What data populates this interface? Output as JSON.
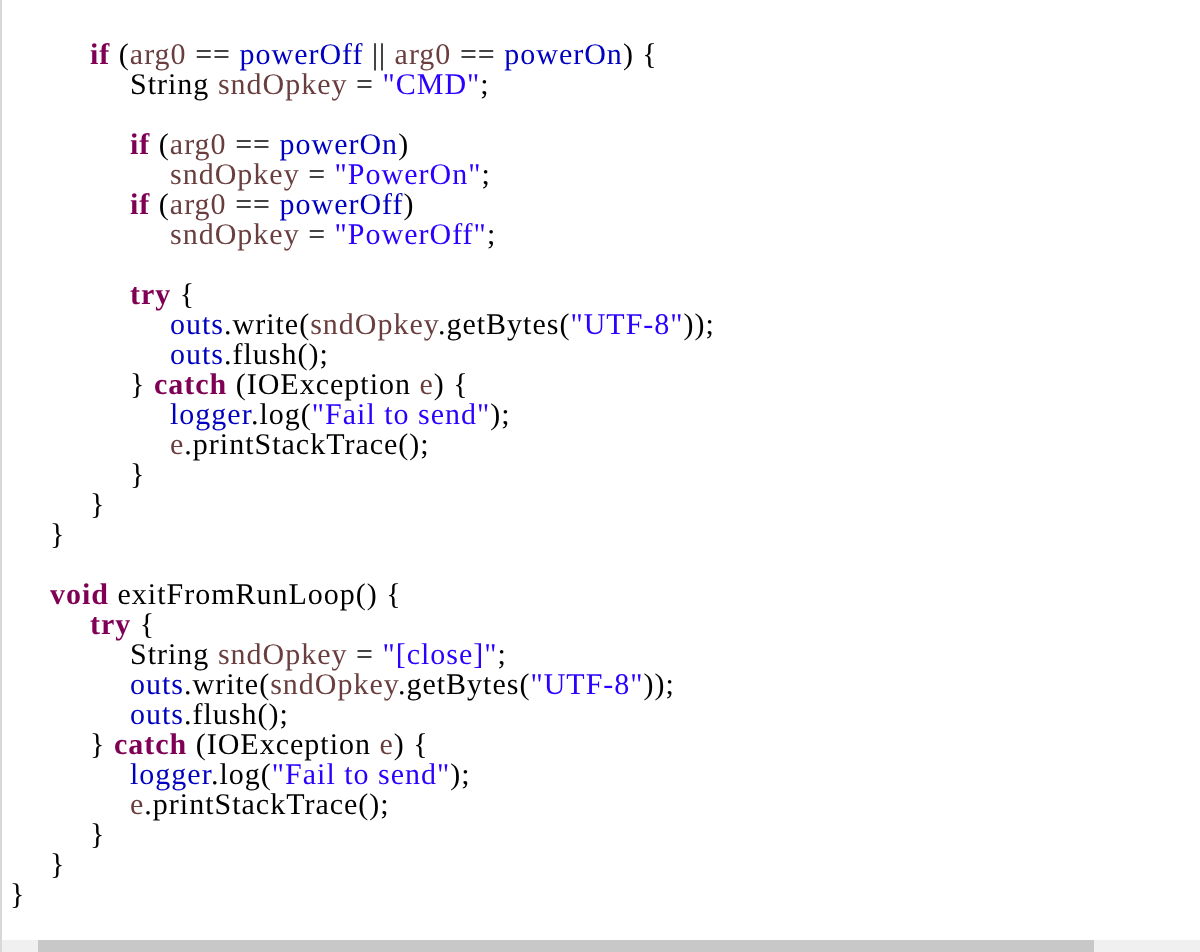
{
  "editor": {
    "lines": [
      {
        "kind": "group",
        "children": [
          {
            "kind": "group",
            "children": [
              {
                "kind": "blank"
              },
              {
                "kind": "code",
                "tokens": [
                  {
                    "kind": "keyword",
                    "text": "if"
                  },
                  {
                    "kind": "plain",
                    "text": " ("
                  },
                  {
                    "kind": "local",
                    "text": "arg0"
                  },
                  {
                    "kind": "plain",
                    "text": " == "
                  },
                  {
                    "kind": "field",
                    "text": "powerOff"
                  },
                  {
                    "kind": "plain",
                    "text": " || "
                  },
                  {
                    "kind": "local",
                    "text": "arg0"
                  },
                  {
                    "kind": "plain",
                    "text": " == "
                  },
                  {
                    "kind": "field",
                    "text": "powerOn"
                  },
                  {
                    "kind": "plain",
                    "text": ") {"
                  }
                ],
                "children": [
                  {
                    "kind": "code",
                    "tokens": [
                      {
                        "kind": "plain",
                        "text": "String "
                      },
                      {
                        "kind": "local",
                        "text": "sndOpkey"
                      },
                      {
                        "kind": "plain",
                        "text": " = "
                      },
                      {
                        "kind": "string",
                        "text": "\"CMD\""
                      },
                      {
                        "kind": "plain",
                        "text": ";"
                      }
                    ]
                  },
                  {
                    "kind": "blank"
                  },
                  {
                    "kind": "code",
                    "tokens": [
                      {
                        "kind": "keyword",
                        "text": "if"
                      },
                      {
                        "kind": "plain",
                        "text": " ("
                      },
                      {
                        "kind": "local",
                        "text": "arg0"
                      },
                      {
                        "kind": "plain",
                        "text": " == "
                      },
                      {
                        "kind": "field",
                        "text": "powerOn"
                      },
                      {
                        "kind": "plain",
                        "text": ")"
                      }
                    ],
                    "children": [
                      {
                        "kind": "code",
                        "tokens": [
                          {
                            "kind": "local",
                            "text": "sndOpkey"
                          },
                          {
                            "kind": "plain",
                            "text": " = "
                          },
                          {
                            "kind": "string",
                            "text": "\"PowerOn\""
                          },
                          {
                            "kind": "plain",
                            "text": ";"
                          }
                        ]
                      }
                    ]
                  },
                  {
                    "kind": "code",
                    "tokens": [
                      {
                        "kind": "keyword",
                        "text": "if"
                      },
                      {
                        "kind": "plain",
                        "text": " ("
                      },
                      {
                        "kind": "local",
                        "text": "arg0"
                      },
                      {
                        "kind": "plain",
                        "text": " == "
                      },
                      {
                        "kind": "field",
                        "text": "powerOff"
                      },
                      {
                        "kind": "plain",
                        "text": ")"
                      }
                    ],
                    "children": [
                      {
                        "kind": "code",
                        "tokens": [
                          {
                            "kind": "local",
                            "text": "sndOpkey"
                          },
                          {
                            "kind": "plain",
                            "text": " = "
                          },
                          {
                            "kind": "string",
                            "text": "\"PowerOff\""
                          },
                          {
                            "kind": "plain",
                            "text": ";"
                          }
                        ]
                      }
                    ]
                  },
                  {
                    "kind": "blank"
                  },
                  {
                    "kind": "code",
                    "tokens": [
                      {
                        "kind": "keyword",
                        "text": "try"
                      },
                      {
                        "kind": "plain",
                        "text": " {"
                      }
                    ],
                    "children": [
                      {
                        "kind": "code",
                        "tokens": [
                          {
                            "kind": "field",
                            "text": "outs"
                          },
                          {
                            "kind": "plain",
                            "text": ".write("
                          },
                          {
                            "kind": "local",
                            "text": "sndOpkey"
                          },
                          {
                            "kind": "plain",
                            "text": ".getBytes("
                          },
                          {
                            "kind": "string",
                            "text": "\"UTF-8\""
                          },
                          {
                            "kind": "plain",
                            "text": "));"
                          }
                        ]
                      },
                      {
                        "kind": "code",
                        "tokens": [
                          {
                            "kind": "field",
                            "text": "outs"
                          },
                          {
                            "kind": "plain",
                            "text": ".flush();"
                          }
                        ]
                      }
                    ]
                  },
                  {
                    "kind": "code",
                    "tokens": [
                      {
                        "kind": "plain",
                        "text": "} "
                      },
                      {
                        "kind": "keyword",
                        "text": "catch"
                      },
                      {
                        "kind": "plain",
                        "text": " (IOException "
                      },
                      {
                        "kind": "local",
                        "text": "e"
                      },
                      {
                        "kind": "plain",
                        "text": ") {"
                      }
                    ],
                    "children": [
                      {
                        "kind": "code",
                        "tokens": [
                          {
                            "kind": "field",
                            "text": "logger"
                          },
                          {
                            "kind": "plain",
                            "text": ".log("
                          },
                          {
                            "kind": "string",
                            "text": "\"Fail to send\""
                          },
                          {
                            "kind": "plain",
                            "text": ");"
                          }
                        ]
                      },
                      {
                        "kind": "code",
                        "tokens": [
                          {
                            "kind": "local",
                            "text": "e"
                          },
                          {
                            "kind": "plain",
                            "text": ".printStackTrace();"
                          }
                        ]
                      }
                    ]
                  },
                  {
                    "kind": "code",
                    "tokens": [
                      {
                        "kind": "plain",
                        "text": "}"
                      }
                    ]
                  }
                ]
              },
              {
                "kind": "code",
                "tokens": [
                  {
                    "kind": "plain",
                    "text": "}"
                  }
                ]
              }
            ]
          },
          {
            "kind": "code",
            "tokens": [
              {
                "kind": "plain",
                "text": "}"
              }
            ]
          },
          {
            "kind": "blank"
          },
          {
            "kind": "code",
            "tokens": [
              {
                "kind": "keyword",
                "text": "void"
              },
              {
                "kind": "plain",
                "text": " exitFromRunLoop() {"
              }
            ],
            "children": [
              {
                "kind": "code",
                "tokens": [
                  {
                    "kind": "keyword",
                    "text": "try"
                  },
                  {
                    "kind": "plain",
                    "text": " {"
                  }
                ],
                "children": [
                  {
                    "kind": "code",
                    "tokens": [
                      {
                        "kind": "plain",
                        "text": "String "
                      },
                      {
                        "kind": "local",
                        "text": "sndOpkey"
                      },
                      {
                        "kind": "plain",
                        "text": " = "
                      },
                      {
                        "kind": "string",
                        "text": "\"[close]\""
                      },
                      {
                        "kind": "plain",
                        "text": ";"
                      }
                    ]
                  },
                  {
                    "kind": "code",
                    "tokens": [
                      {
                        "kind": "field",
                        "text": "outs"
                      },
                      {
                        "kind": "plain",
                        "text": ".write("
                      },
                      {
                        "kind": "local",
                        "text": "sndOpkey"
                      },
                      {
                        "kind": "plain",
                        "text": ".getBytes("
                      },
                      {
                        "kind": "string",
                        "text": "\"UTF-8\""
                      },
                      {
                        "kind": "plain",
                        "text": "));"
                      }
                    ]
                  },
                  {
                    "kind": "code",
                    "tokens": [
                      {
                        "kind": "field",
                        "text": "outs"
                      },
                      {
                        "kind": "plain",
                        "text": ".flush();"
                      }
                    ]
                  }
                ]
              },
              {
                "kind": "code",
                "tokens": [
                  {
                    "kind": "plain",
                    "text": "} "
                  },
                  {
                    "kind": "keyword",
                    "text": "catch"
                  },
                  {
                    "kind": "plain",
                    "text": " (IOException "
                  },
                  {
                    "kind": "local",
                    "text": "e"
                  },
                  {
                    "kind": "plain",
                    "text": ") {"
                  }
                ],
                "children": [
                  {
                    "kind": "code",
                    "tokens": [
                      {
                        "kind": "field",
                        "text": "logger"
                      },
                      {
                        "kind": "plain",
                        "text": ".log("
                      },
                      {
                        "kind": "string",
                        "text": "\"Fail to send\""
                      },
                      {
                        "kind": "plain",
                        "text": ");"
                      }
                    ]
                  },
                  {
                    "kind": "code",
                    "tokens": [
                      {
                        "kind": "local",
                        "text": "e"
                      },
                      {
                        "kind": "plain",
                        "text": ".printStackTrace();"
                      }
                    ]
                  }
                ]
              },
              {
                "kind": "code",
                "tokens": [
                  {
                    "kind": "plain",
                    "text": "}"
                  }
                ]
              }
            ]
          },
          {
            "kind": "code",
            "tokens": [
              {
                "kind": "plain",
                "text": "}"
              }
            ]
          }
        ]
      },
      {
        "kind": "code",
        "tokens": [
          {
            "kind": "plain",
            "text": "}"
          }
        ]
      }
    ]
  }
}
